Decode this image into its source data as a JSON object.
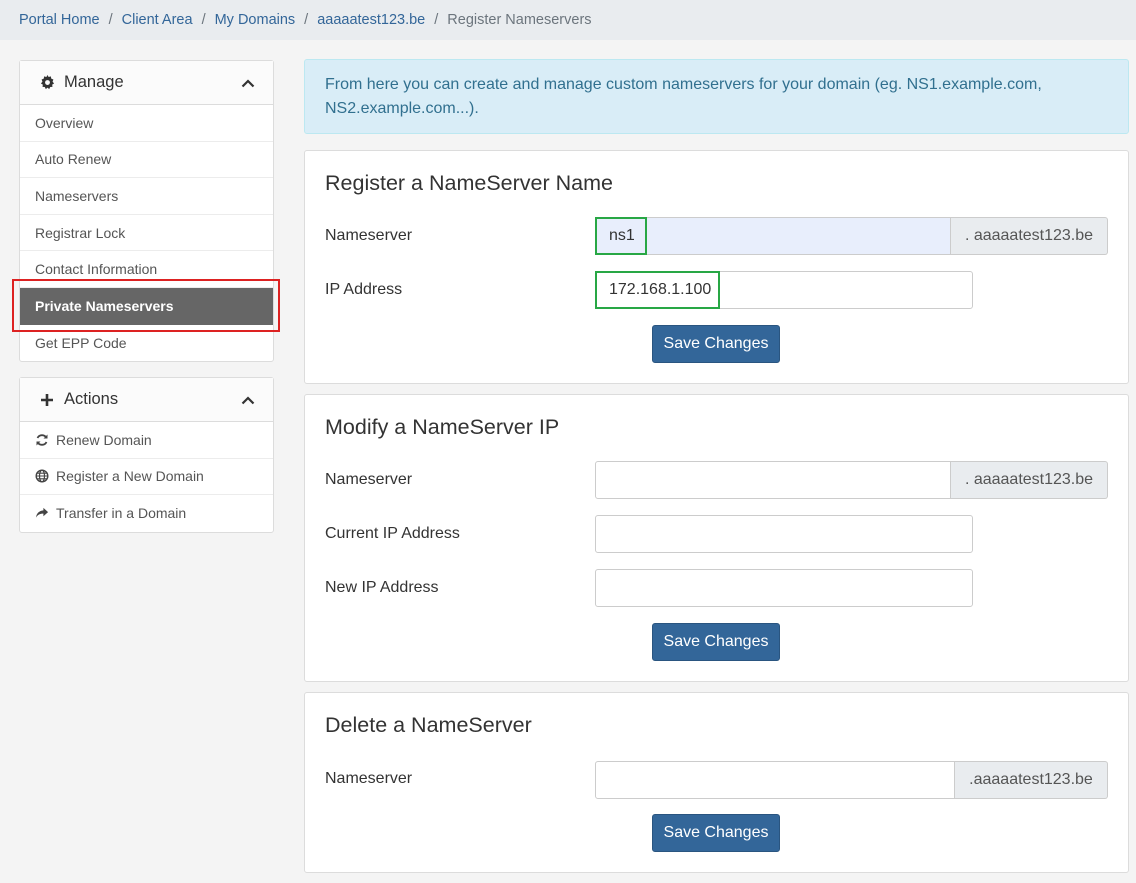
{
  "breadcrumb": {
    "items": [
      "Portal Home",
      "Client Area",
      "My Domains",
      "aaaaatest123.be"
    ],
    "current": "Register Nameservers",
    "separator": "/"
  },
  "sidebar": {
    "manage": {
      "title": "Manage",
      "items": [
        "Overview",
        "Auto Renew",
        "Nameservers",
        "Registrar Lock",
        "Contact Information",
        "Private Nameservers",
        "Get EPP Code"
      ],
      "active": "Private Nameservers"
    },
    "actions": {
      "title": "Actions",
      "items": [
        {
          "label": "Renew Domain",
          "icon": "refresh-icon"
        },
        {
          "label": "Register a New Domain",
          "icon": "globe-icon"
        },
        {
          "label": "Transfer in a Domain",
          "icon": "share-icon"
        }
      ]
    }
  },
  "info_text": "From here you can create and manage custom nameservers for your domain (eg. NS1.example.com, NS2.example.com...).",
  "register": {
    "title": "Register a NameServer Name",
    "ns_label": "Nameserver",
    "ns_value": "ns1",
    "ns_suffix": ". aaaaatest123.be",
    "ip_label": "IP Address",
    "ip_value": "172.168.1.100",
    "save": "Save Changes"
  },
  "modify": {
    "title": "Modify a NameServer IP",
    "ns_label": "Nameserver",
    "ns_value": "",
    "ns_suffix": ". aaaaatest123.be",
    "current_label": "Current IP Address",
    "current_value": "",
    "new_label": "New IP Address",
    "new_value": "",
    "save": "Save Changes"
  },
  "delete": {
    "title": "Delete a NameServer",
    "ns_label": "Nameserver",
    "ns_value": "",
    "ns_suffix": ".aaaaatest123.be",
    "save": "Save Changes"
  },
  "colors": {
    "link": "#336699",
    "button": "#336699",
    "active_item": "#666666",
    "alert_bg": "#d9edf7",
    "highlight_red": "#dd2222",
    "highlight_green": "#28a745"
  }
}
